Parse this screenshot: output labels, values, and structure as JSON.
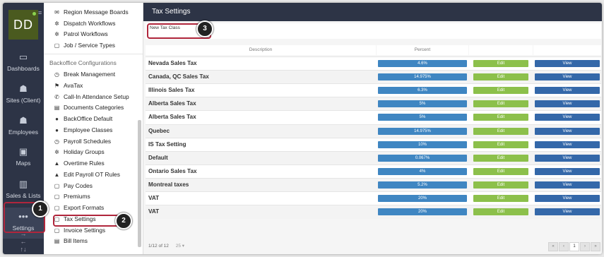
{
  "rail": {
    "avatar": "DD",
    "items": [
      {
        "label": "Dashboards",
        "icon": "monitor-icon",
        "glyph": "▭"
      },
      {
        "label": "Sites (Client)",
        "icon": "people-icon",
        "glyph": "☗"
      },
      {
        "label": "Employees",
        "icon": "people-icon",
        "glyph": "☗"
      },
      {
        "label": "Maps",
        "icon": "map-icon",
        "glyph": "▣"
      },
      {
        "label": "Sales & Lists",
        "icon": "bar-chart-icon",
        "glyph": "▥"
      },
      {
        "label": "Settings",
        "icon": "more-dots-icon",
        "glyph": "•••"
      }
    ]
  },
  "sidebar": {
    "top_items": [
      {
        "label": "Region Message Boards",
        "glyph": "✉"
      },
      {
        "label": "Dispatch Workflows",
        "glyph": "✲"
      },
      {
        "label": "Patrol Workflows",
        "glyph": "✲"
      },
      {
        "label": "Job / Service Types",
        "glyph": "▢"
      }
    ],
    "section_header": "Backoffice Configurations",
    "items": [
      {
        "label": "Break Management",
        "glyph": "◷"
      },
      {
        "label": "AvaTax",
        "glyph": "⚑"
      },
      {
        "label": "Call-In Attendance Setup",
        "glyph": "✆"
      },
      {
        "label": "Documents Categories",
        "glyph": "▤"
      },
      {
        "label": "BackOffice Default",
        "glyph": "●"
      },
      {
        "label": "Employee Classes",
        "glyph": "●"
      },
      {
        "label": "Payroll Schedules",
        "glyph": "◷"
      },
      {
        "label": "Holiday Groups",
        "glyph": "✲"
      },
      {
        "label": "Overtime Rules",
        "glyph": "▲"
      },
      {
        "label": "Edit Payroll OT Rules",
        "glyph": "▲"
      },
      {
        "label": "Pay Codes",
        "glyph": "▢"
      },
      {
        "label": "Premiums",
        "glyph": "▢"
      },
      {
        "label": "Export Formats",
        "glyph": "▢"
      },
      {
        "label": "Tax Settings",
        "glyph": "▢"
      },
      {
        "label": "Invoice Settings",
        "glyph": "▢"
      },
      {
        "label": "Bill Items",
        "glyph": "▤"
      }
    ]
  },
  "main": {
    "title": "Tax Settings",
    "new_button": "New Tax Class",
    "columns": [
      "Description",
      "Percent",
      "",
      ""
    ],
    "rows": [
      {
        "description": "Nevada Sales Tax",
        "percent": "4.6%",
        "edit": "Edit",
        "view": "View"
      },
      {
        "description": "Canada, QC Sales Tax",
        "percent": "14.975%",
        "edit": "Edit",
        "view": "View"
      },
      {
        "description": "Illinois Sales Tax",
        "percent": "6.3%",
        "edit": "Edit",
        "view": "View"
      },
      {
        "description": "Alberta Sales Tax",
        "percent": "5%",
        "edit": "Edit",
        "view": "View"
      },
      {
        "description": "Alberta Sales Tax",
        "percent": "5%",
        "edit": "Edit",
        "view": "View"
      },
      {
        "description": "Quebec",
        "percent": "14.975%",
        "edit": "Edit",
        "view": "View"
      },
      {
        "description": "IS Tax Setting",
        "percent": "10%",
        "edit": "Edit",
        "view": "View"
      },
      {
        "description": "Default",
        "percent": "0.067%",
        "edit": "Edit",
        "view": "View"
      },
      {
        "description": "Ontario Sales Tax",
        "percent": "4%",
        "edit": "Edit",
        "view": "View"
      },
      {
        "description": "Montreal taxes",
        "percent": "5.2%",
        "edit": "Edit",
        "view": "View"
      },
      {
        "description": "VAT",
        "percent": "20%",
        "edit": "Edit",
        "view": "View"
      },
      {
        "description": "VAT",
        "percent": "20%",
        "edit": "Edit",
        "view": "View"
      }
    ],
    "pager_info": "1/12 of 12",
    "page_size": "25",
    "pages": [
      "«",
      "‹",
      "1",
      "›",
      "»"
    ]
  },
  "callouts": [
    "1",
    "2",
    "3"
  ],
  "colors": {
    "nav_bg": "#2d3446",
    "percent": "#3f86c2",
    "edit": "#8cc04b",
    "view": "#3468a9",
    "highlight": "#b0263c"
  }
}
